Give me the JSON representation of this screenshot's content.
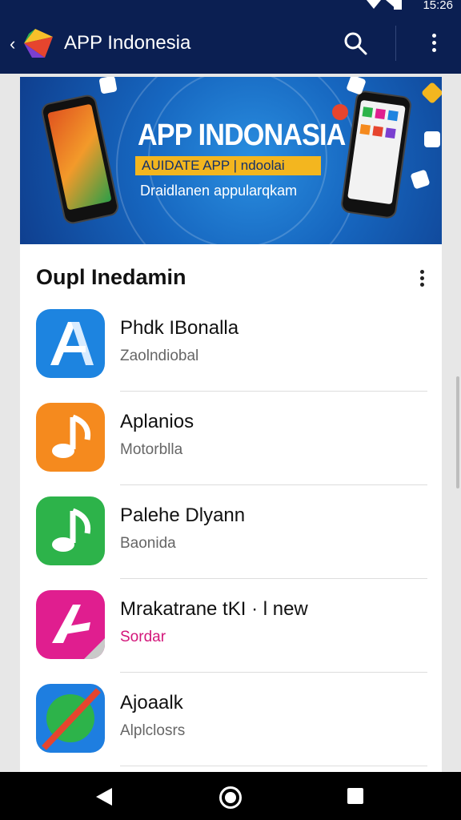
{
  "status_bar": {
    "time": "15:26"
  },
  "app_bar": {
    "title": "APP Indonesia"
  },
  "banner": {
    "title": "APP INDONASIA",
    "pill": "AUIDATE APP | ndoolai",
    "subtitle": "Draidlanen appularqkam"
  },
  "section": {
    "title": "Oupl Inedamin"
  },
  "apps": [
    {
      "name": "Phdk IBonalla",
      "sub": "Zaolndiobal",
      "icon": "a-letter-icon",
      "color": "#1d84e0",
      "sub_color": "#666666"
    },
    {
      "name": "Aplanios",
      "sub": "Motorblla",
      "icon": "music-note-icon",
      "color": "#f58a1e",
      "sub_color": "#666666"
    },
    {
      "name": "Palehe Dlyann",
      "sub": "Baonida",
      "icon": "music-note-icon",
      "color": "#2db34a",
      "sub_color": "#666666"
    },
    {
      "name": "Mrakatrane tKI · l new",
      "sub": "Sordar",
      "icon": "a-letter-icon",
      "color": "#e01e8f",
      "sub_color": "#d3167a"
    },
    {
      "name": "Ajoaalk",
      "sub": "Alplclosrs",
      "icon": "slash-circle-icon",
      "color": "#1e7ee0",
      "sub_color": "#666666"
    }
  ]
}
